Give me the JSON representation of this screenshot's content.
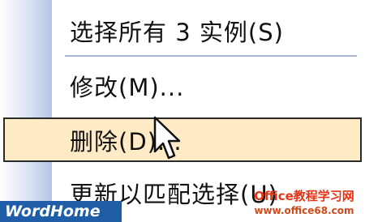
{
  "menu": {
    "items": [
      {
        "label": "选择所有 3 实例(S)"
      },
      {
        "label": "修改(M)..."
      },
      {
        "label": "删除(D)..."
      },
      {
        "label": "更新以匹配选择(U)"
      }
    ]
  },
  "watermark": {
    "left_text": "WordHome",
    "right_title": "Office教程学习网",
    "right_url": "www.office68.com"
  },
  "colors": {
    "highlight": "#ffecc6",
    "gutter": "#b5c6e6",
    "watermark_blue": "#1f5da8",
    "watermark_red": "#e53314"
  },
  "icons": {
    "cursor": "mouse-pointer-icon"
  }
}
